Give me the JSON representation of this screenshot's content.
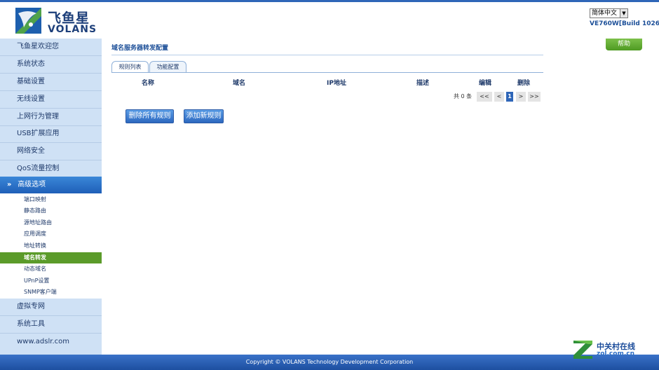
{
  "brand": {
    "name_cn": "飞鱼星",
    "name_en": "VOLANS",
    "colors": {
      "header_blue": "#2f66b8",
      "sidebar_bg": "#cfe1f5",
      "active_sub": "#5b9b2a",
      "help_green": "#5ba82c"
    }
  },
  "header": {
    "language": "简体中文",
    "build": "VE760W[Build 1026]"
  },
  "sidebar": {
    "items": [
      {
        "label": "飞鱼星欢迎您"
      },
      {
        "label": "系统状态"
      },
      {
        "label": "基础设置"
      },
      {
        "label": "无线设置"
      },
      {
        "label": "上网行为管理"
      },
      {
        "label": "USB扩展应用"
      },
      {
        "label": "网络安全"
      },
      {
        "label": "QoS流量控制"
      },
      {
        "label": "高级选项",
        "expanded": true,
        "icon": "double-chevron-down-icon"
      },
      {
        "label": "虚拟专网"
      },
      {
        "label": "系统工具"
      },
      {
        "label": "www.adslr.com"
      }
    ],
    "subitems": [
      {
        "label": "端口映射"
      },
      {
        "label": "静态路由"
      },
      {
        "label": "源地址路由"
      },
      {
        "label": "应用调度"
      },
      {
        "label": "地址转换"
      },
      {
        "label": "域名转发",
        "active": true
      },
      {
        "label": "动态域名"
      },
      {
        "label": "UPnP设置"
      },
      {
        "label": "SNMP客户端"
      }
    ]
  },
  "main": {
    "title": "域名服务器转发配置",
    "help": "帮助",
    "tabs": [
      {
        "label": "规则列表",
        "active": true
      },
      {
        "label": "功能配置",
        "active": false
      }
    ],
    "columns": [
      "名称",
      "域名",
      "IP地址",
      "描述",
      "编辑",
      "删除"
    ],
    "pager": {
      "total": "共 0 条",
      "first": "<<",
      "prev": "<",
      "current": "1",
      "next": ">",
      "last": ">>"
    },
    "buttons": {
      "delete_all": "删除所有规则",
      "add_new": "添加新规则"
    }
  },
  "footer": {
    "copyright": "Copyright © VOLANS Technology Development Corporation"
  },
  "watermark": {
    "cn": "中关村在线",
    "en": "zol.com.cn"
  }
}
